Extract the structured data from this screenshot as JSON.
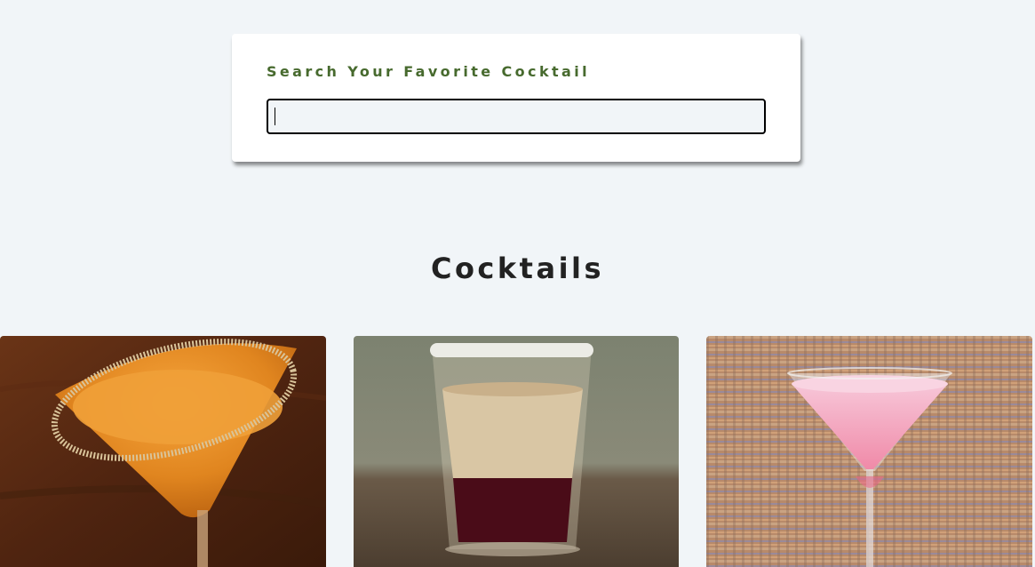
{
  "search": {
    "label": "Search Your Favorite Cocktail",
    "value": "",
    "placeholder": ""
  },
  "section": {
    "title": "Cocktails"
  },
  "cocktails": [
    {
      "image": "orange-cocktail-sugar-rim-image"
    },
    {
      "image": "layered-shot-glass-image"
    },
    {
      "image": "pink-martini-image"
    }
  ]
}
